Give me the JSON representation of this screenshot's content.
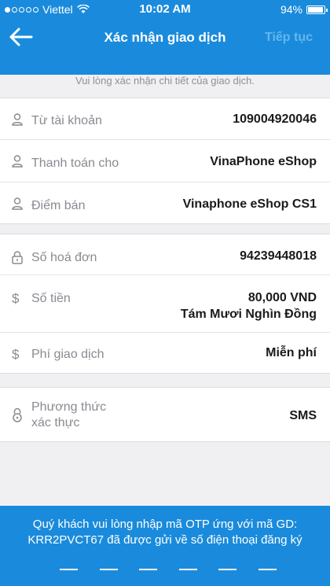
{
  "status": {
    "carrier": "Viettel",
    "time": "10:02 AM",
    "battery": "94%",
    "battery_level": 0.94
  },
  "nav": {
    "title": "Xác nhận giao dịch",
    "next_label": "Tiếp tục"
  },
  "subtitle": "Vui lòng xác nhận chi tiết của giao dịch.",
  "account_section": [
    {
      "label": "Từ tài khoản",
      "value": "109004920046",
      "icon": "person-icon"
    },
    {
      "label": "Thanh toán cho",
      "value": "VinaPhone eShop",
      "icon": "person-icon"
    },
    {
      "label": "Điểm bán",
      "value": "Vinaphone eShop CS1",
      "icon": "person-icon"
    }
  ],
  "payment_section": {
    "invoice": {
      "label": "Số hoá đơn",
      "value": "94239448018",
      "icon": "lock-icon"
    },
    "amount": {
      "label": "Số tiền",
      "value": "80,000 VND",
      "value_words": "Tám Mươi Nghìn Đồng",
      "icon": "dollar-icon"
    },
    "fee": {
      "label": "Phí giao dịch",
      "value": "Miễn phí",
      "icon": "dollar-icon"
    }
  },
  "auth_section": {
    "method": {
      "label_line1": "Phương thức",
      "label_line2": "xác thực",
      "value": "SMS",
      "icon": "lock-open-icon"
    }
  },
  "otp": {
    "line1": "Quý khách vui lòng nhập mã OTP ứng với mã GD:",
    "line2": "KRR2PVCT67 đã được gửi về số điện thoại đăng ký",
    "slots": 6
  },
  "colors": {
    "primary": "#1a8bdc",
    "background": "#f0f0f3"
  }
}
